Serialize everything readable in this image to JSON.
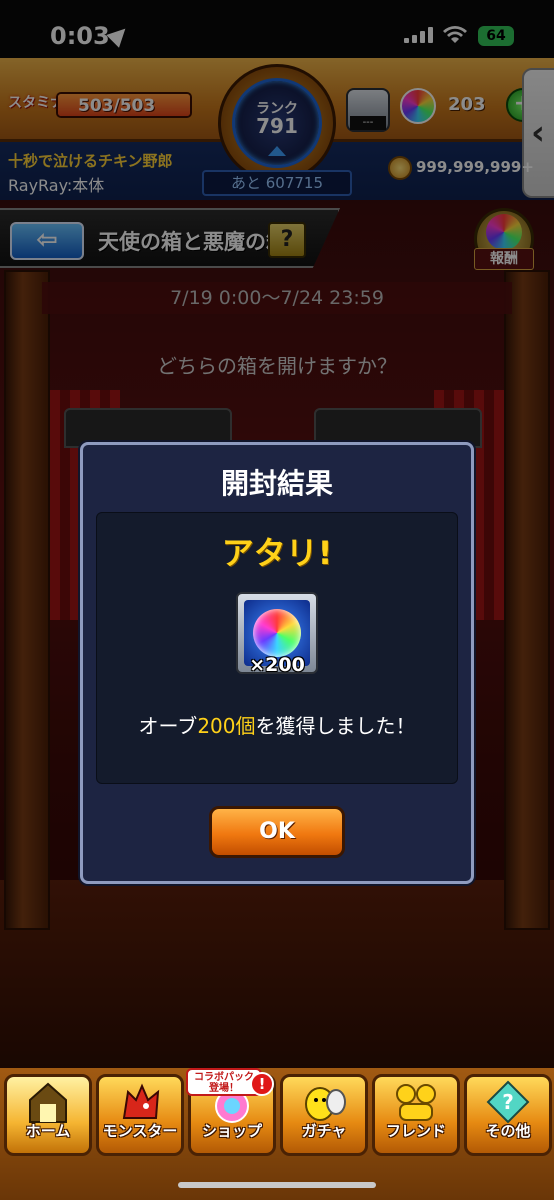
{
  "status_bar": {
    "time": "0:03",
    "battery": "64"
  },
  "header": {
    "stamina_tag": "スタミナ",
    "stamina": "503/503",
    "stamina_fraction": 1.0,
    "rank_label": "ランク",
    "rank": "791",
    "luck_value": "---",
    "orb_count": "203",
    "add_orb": "+",
    "side_tab": "‹",
    "player_title": "十秒で泣けるチキン野郎",
    "player_name": "RayRay:本体",
    "next_rank": "あと 607715",
    "coins": "999,999,999+"
  },
  "event": {
    "back": "⇦",
    "title": "天使の箱と悪魔の箱",
    "help": "?",
    "reward_label": "報酬",
    "period": "7/19 0:00〜7/24 23:59",
    "question": "どちらの箱を開けますか？"
  },
  "modal": {
    "title": "開封結果",
    "result": "アタリ!",
    "item_qty": "×200",
    "message_pre": "オーブ",
    "message_highlight": "200個",
    "message_post": "を獲得しました！",
    "ok": "OK"
  },
  "nav": {
    "items": [
      {
        "label": "ホーム",
        "icon": "home-icon"
      },
      {
        "label": "モンスター",
        "icon": "monster-icon"
      },
      {
        "label": "ショップ",
        "icon": "shop-icon"
      },
      {
        "label": "ガチャ",
        "icon": "gacha-icon"
      },
      {
        "label": "フレンド",
        "icon": "friend-icon"
      },
      {
        "label": "その他",
        "icon": "other-icon"
      }
    ],
    "shop_badge_line1": "コラボパック",
    "shop_badge_line2": "登場！",
    "shop_alert": "!"
  },
  "colors": {
    "accent": "#ffd119",
    "ok_button": "#f07810",
    "modal_bg": "#1d2442"
  }
}
